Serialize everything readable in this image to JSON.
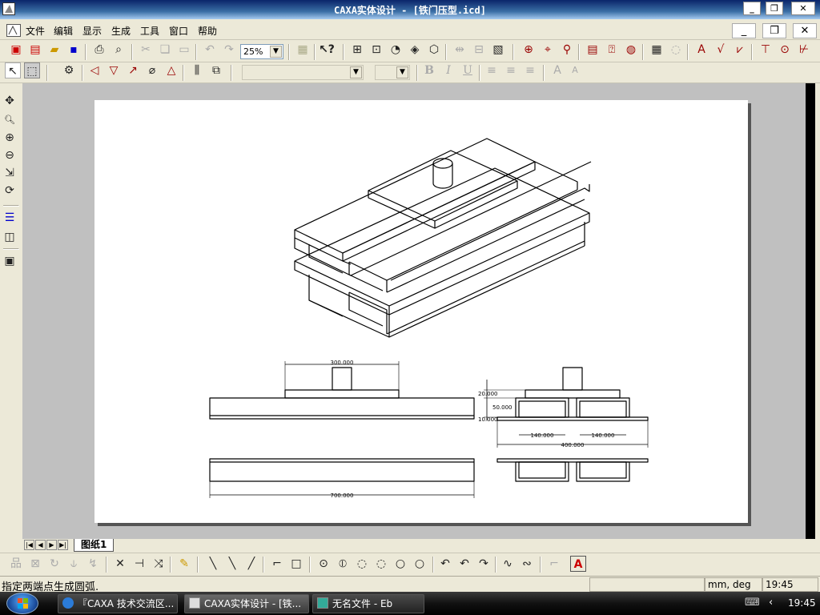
{
  "window": {
    "title": "CAXA实体设计 - [铁门压型.icd]"
  },
  "menu": {
    "items": [
      "文件",
      "编辑",
      "显示",
      "生成",
      "工具",
      "窗口",
      "帮助"
    ]
  },
  "toolbar": {
    "zoom_value": "25%"
  },
  "format_bar": {
    "bold": "B",
    "italic": "I",
    "underline": "U"
  },
  "drawing": {
    "dims": {
      "top_width": "300.000",
      "overall_length": "700.000",
      "h20": "20.000",
      "h50": "50.000",
      "h10": "10.000",
      "w140a": "140.000",
      "w140b": "140.000",
      "w400": "400.000"
    }
  },
  "sheet_tabs": {
    "active": "图纸1"
  },
  "status": {
    "prompt": "指定两端点生成圆弧.",
    "units": "mm, deg",
    "mode": "r",
    "time": "19:45"
  },
  "taskbar": {
    "tasks": [
      "『CAXA 技术交流区...",
      "CAXA实体设计 - [铁...",
      "无名文件 - Eb"
    ],
    "clock": "19:45"
  },
  "colors": {
    "titlebar": "#0a246a",
    "paper": "#ffffff",
    "canvas": "#c0c0c0",
    "taskbar": "#000000"
  }
}
